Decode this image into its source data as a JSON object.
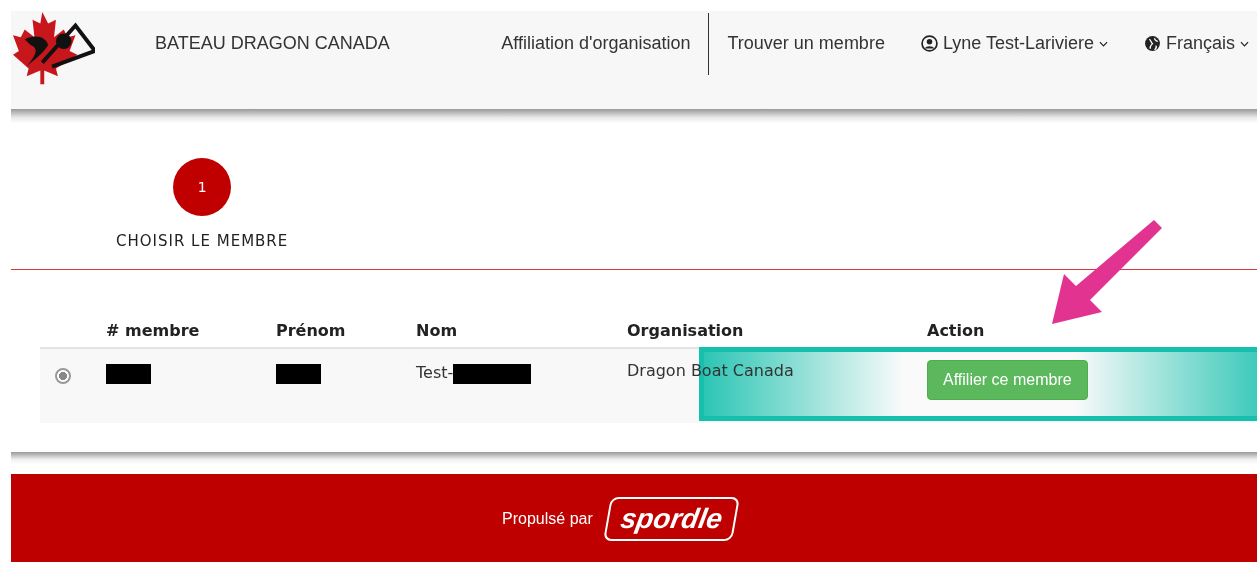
{
  "header": {
    "brand": "BATEAU DRAGON CANADA",
    "nav": [
      {
        "label": "Affiliation d'organisation",
        "kind": "link"
      },
      {
        "label": "Trouver un membre",
        "kind": "link"
      },
      {
        "label": "Lyne Test-Lariviere",
        "kind": "user"
      },
      {
        "label": "Français",
        "kind": "language"
      }
    ]
  },
  "stepper": {
    "steps": [
      {
        "number": "1",
        "label": "CHOISIR LE MEMBRE",
        "selected": true
      }
    ]
  },
  "table": {
    "columns": [
      "# membre",
      "Prénom",
      "Nom",
      "Organisation",
      "Action"
    ],
    "rows": [
      {
        "selected": true,
        "cells": [
          {
            "kind": "redacted"
          },
          {
            "kind": "redacted"
          },
          {
            "kind": "partial",
            "text": "Test-"
          },
          {
            "kind": "text",
            "text": "Dragon Boat Canada"
          },
          {
            "kind": "button",
            "text": "Affilier ce membre"
          }
        ]
      }
    ]
  },
  "footer": {
    "powered_by": "Propulsé par",
    "logo": "spordle"
  }
}
